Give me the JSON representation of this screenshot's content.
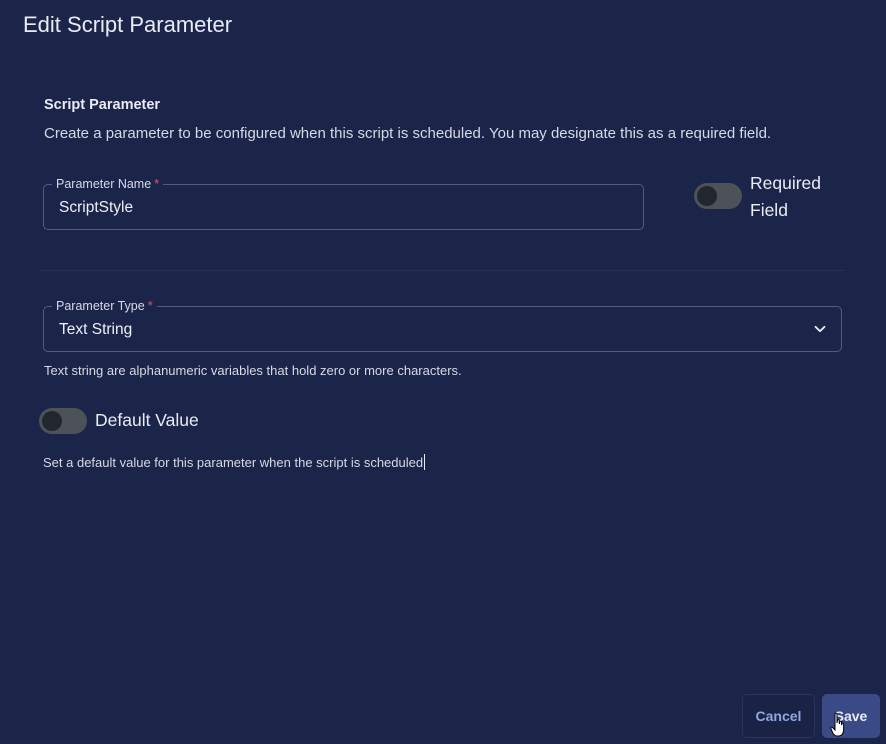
{
  "dialog": {
    "title": "Edit Script Parameter"
  },
  "section": {
    "heading": "Script Parameter",
    "description": "Create a parameter to be configured when this script is scheduled. You may designate this as a required field."
  },
  "parameter_name": {
    "label": "Parameter Name",
    "required_marker": "*",
    "value": "ScriptStyle"
  },
  "required_field": {
    "label": "Required Field",
    "on": false
  },
  "parameter_type": {
    "label": "Parameter Type",
    "required_marker": "*",
    "selected": "Text String",
    "helper": "Text string are alphanumeric variables that hold zero or more characters.",
    "icon": "chevron-down-icon"
  },
  "default_value": {
    "label": "Default Value",
    "on": false,
    "helper": "Set a default value for this parameter when the script is scheduled"
  },
  "actions": {
    "cancel_label": "Cancel",
    "save_label": "Save"
  },
  "colors": {
    "background": "#1b2449",
    "field_border": "#535c80",
    "required_marker": "#e05a6a",
    "save_button": "#3a4a86",
    "cancel_text": "#8fa8e0",
    "toggle_track": "#4d5258"
  }
}
